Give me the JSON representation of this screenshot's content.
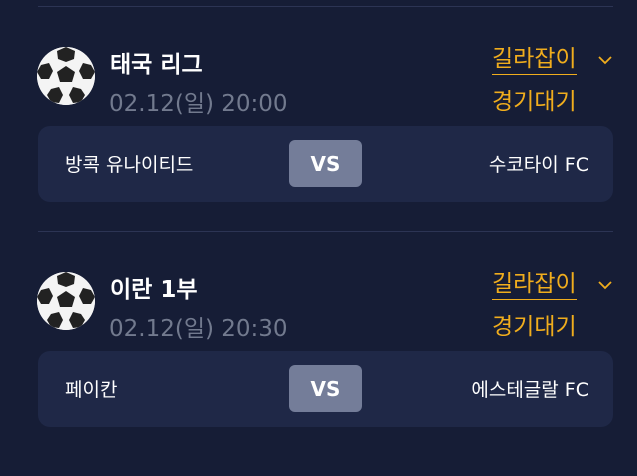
{
  "matches": [
    {
      "league": "태국 리그",
      "datetime": "02.12(일) 20:00",
      "guide_label": "길라잡이",
      "status": "경기대기",
      "home_team": "방콕 유나이티드",
      "vs_label": "VS",
      "away_team": "수코타이 FC"
    },
    {
      "league": "이란 1부",
      "datetime": "02.12(일) 20:30",
      "guide_label": "길라잡이",
      "status": "경기대기",
      "home_team": "페이칸",
      "vs_label": "VS",
      "away_team": "에스테글랄 FC"
    }
  ],
  "colors": {
    "background": "#161d36",
    "card": "#1f2847",
    "accent": "#f0ad1d",
    "muted_text": "#727a8e",
    "vs_badge": "#747d99"
  },
  "icons": {
    "league_icon": "soccer-ball-icon",
    "expand_icon": "chevron-down-icon"
  }
}
